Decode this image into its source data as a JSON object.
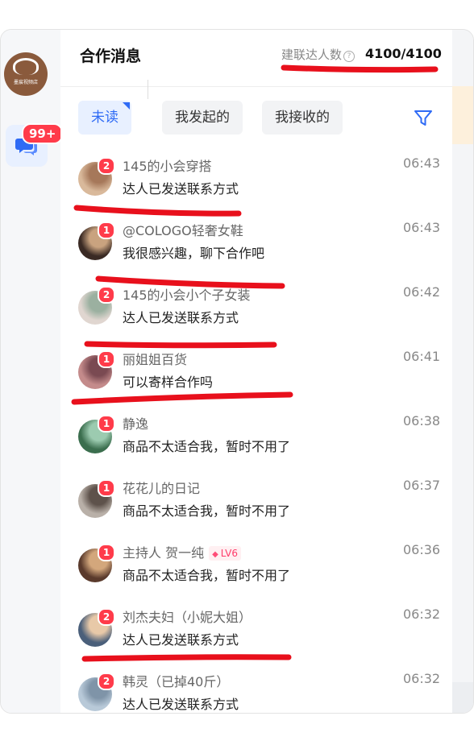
{
  "header": {
    "title": "合作消息",
    "count_label": "建联达人数",
    "count_value": "4100/4100"
  },
  "rail": {
    "logo_text": "墨宸视频店",
    "badge": "99+"
  },
  "tabs": [
    "未读",
    "我发起的",
    "我接收的"
  ],
  "colors": {
    "accent": "#2f6bf5",
    "badge": "#ff3b4a",
    "marker": "#e8101c"
  },
  "conversations": [
    {
      "name": "145的小会穿搭",
      "message": "达人已发送联系方式",
      "time": "06:43",
      "unread": "2",
      "level": ""
    },
    {
      "name": "@COLOGO轻奢女鞋",
      "message": "我很感兴趣，聊下合作吧",
      "time": "06:43",
      "unread": "1",
      "level": ""
    },
    {
      "name": "145的小会小个子女装",
      "message": "达人已发送联系方式",
      "time": "06:42",
      "unread": "2",
      "level": ""
    },
    {
      "name": "丽姐姐百货",
      "message": "可以寄样合作吗",
      "time": "06:41",
      "unread": "1",
      "level": ""
    },
    {
      "name": "静逸",
      "message": "商品不太适合我，暂时不用了",
      "time": "06:38",
      "unread": "1",
      "level": ""
    },
    {
      "name": "花花儿的日记",
      "message": "商品不太适合我，暂时不用了",
      "time": "06:37",
      "unread": "1",
      "level": ""
    },
    {
      "name": "主持人 贺一纯",
      "message": "商品不太适合我，暂时不用了",
      "time": "06:36",
      "unread": "1",
      "level": "LV6"
    },
    {
      "name": "刘杰夫妇（小妮大姐）",
      "message": "达人已发送联系方式",
      "time": "06:32",
      "unread": "2",
      "level": ""
    },
    {
      "name": "韩灵（已掉40斤）",
      "message": "达人已发送联系方式",
      "time": "06:32",
      "unread": "2",
      "level": ""
    }
  ]
}
